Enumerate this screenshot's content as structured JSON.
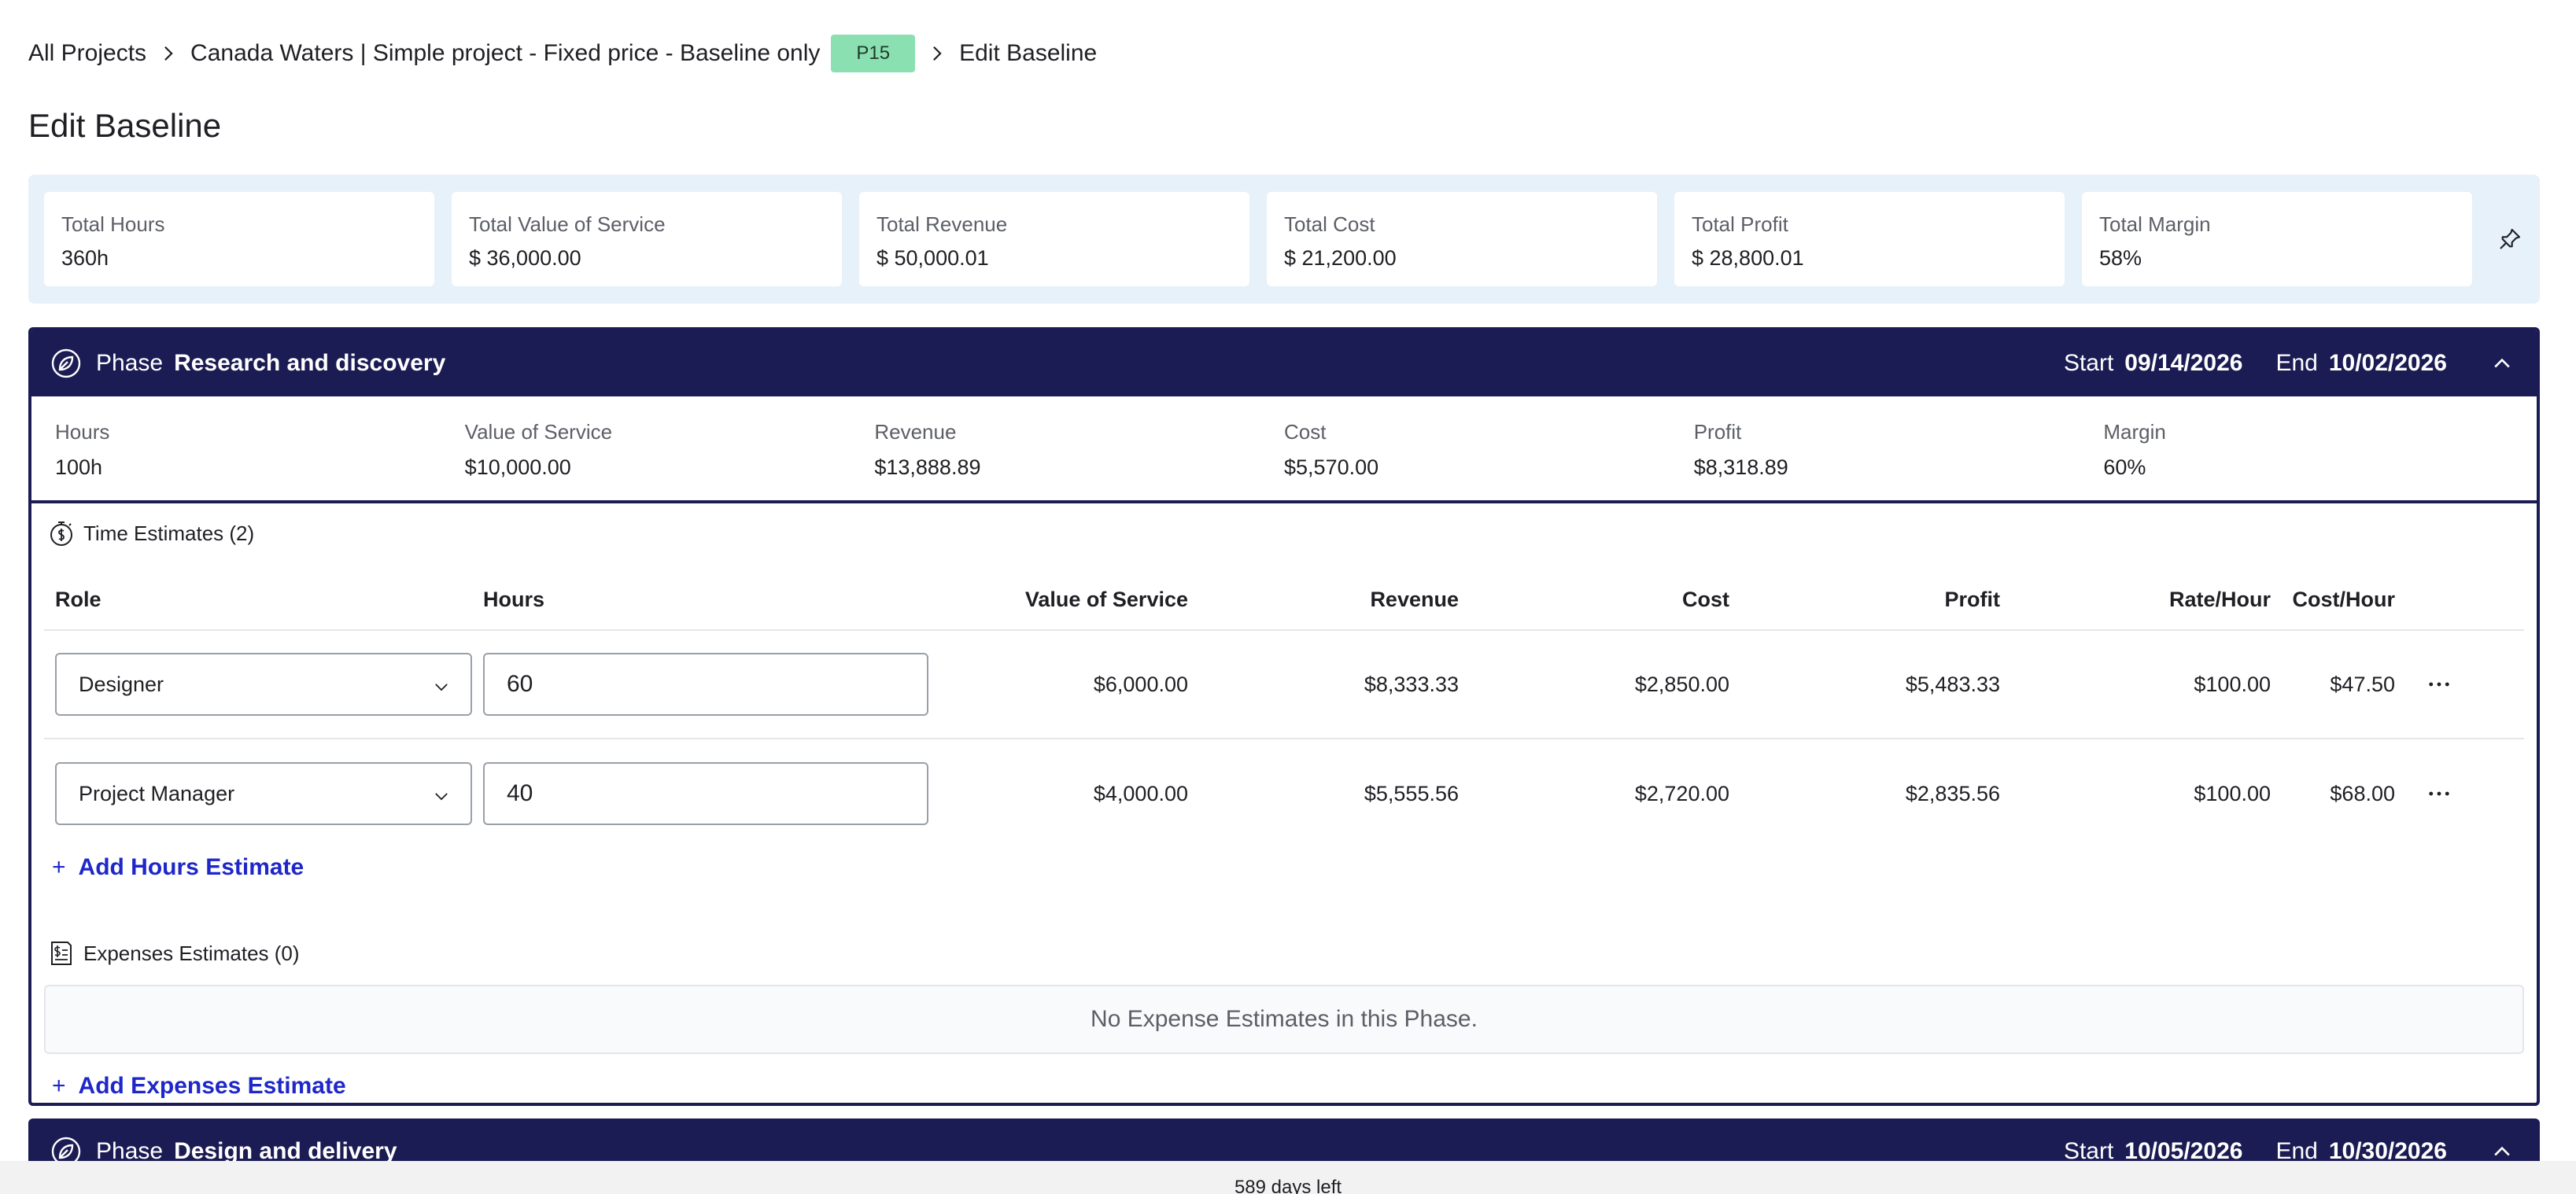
{
  "breadcrumb": {
    "all_projects": "All Projects",
    "project": "Canada Waters | Simple project - Fixed price - Baseline only",
    "badge": "P15",
    "current": "Edit Baseline"
  },
  "page_title": "Edit Baseline",
  "summary": {
    "items": [
      {
        "label": "Total Hours",
        "value": "360h"
      },
      {
        "label": "Total Value of Service",
        "value": "$ 36,000.00"
      },
      {
        "label": "Total Revenue",
        "value": "$ 50,000.01"
      },
      {
        "label": "Total Cost",
        "value": "$ 21,200.00"
      },
      {
        "label": "Total Profit",
        "value": "$ 28,800.01"
      },
      {
        "label": "Total Margin",
        "value": "58%"
      }
    ]
  },
  "phase1": {
    "word": "Phase",
    "name": "Research and discovery",
    "start_label": "Start",
    "start": "09/14/2026",
    "end_label": "End",
    "end": "10/02/2026",
    "stats": [
      {
        "label": "Hours",
        "value": "100h"
      },
      {
        "label": "Value of Service",
        "value": "$10,000.00"
      },
      {
        "label": "Revenue",
        "value": "$13,888.89"
      },
      {
        "label": "Cost",
        "value": "$5,570.00"
      },
      {
        "label": "Profit",
        "value": "$8,318.89"
      },
      {
        "label": "Margin",
        "value": "60%"
      }
    ],
    "time_title": "Time Estimates (2)",
    "columns": {
      "role": "Role",
      "hours": "Hours",
      "vos": "Value of Service",
      "revenue": "Revenue",
      "cost": "Cost",
      "profit": "Profit",
      "rate": "Rate/Hour",
      "cost_hour": "Cost/Hour"
    },
    "rows": [
      {
        "role": "Designer",
        "hours": "60",
        "vos": "$6,000.00",
        "revenue": "$8,333.33",
        "cost": "$2,850.00",
        "profit": "$5,483.33",
        "rate": "$100.00",
        "cost_hour": "$47.50"
      },
      {
        "role": "Project Manager",
        "hours": "40",
        "vos": "$4,000.00",
        "revenue": "$5,555.56",
        "cost": "$2,720.00",
        "profit": "$2,835.56",
        "rate": "$100.00",
        "cost_hour": "$68.00"
      }
    ],
    "add_hours": "Add Hours Estimate",
    "expenses_title": "Expenses Estimates (0)",
    "expenses_empty": "No Expense Estimates in this Phase.",
    "add_expenses": "Add Expenses Estimate"
  },
  "phase2": {
    "word": "Phase",
    "name": "Design and delivery",
    "start_label": "Start",
    "start": "10/05/2026",
    "end_label": "End",
    "end": "10/30/2026"
  },
  "status": {
    "text": "589 days left"
  },
  "colors": {
    "phase_header": "#1c1c54",
    "summary_bg": "#e6f1fa",
    "badge_bg": "#8be0b1",
    "link": "#1f27c9"
  }
}
